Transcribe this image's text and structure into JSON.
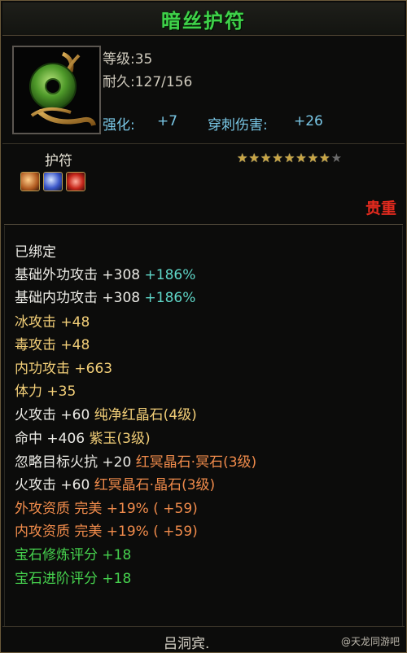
{
  "title": "暗丝护符",
  "stats": {
    "level": "等级:35",
    "durability": "耐久:127/156",
    "enhance_label": "强化:",
    "enhance_value": "+7",
    "pierce_label": "穿刺伤害:",
    "pierce_value": "+26"
  },
  "item_type": "护符",
  "stars": {
    "filled": 8,
    "total": 9
  },
  "valuable": "贵重",
  "attributes": {
    "bound": "已绑定",
    "ext_atk_label": "基础外功攻击",
    "ext_atk_value": "+308",
    "ext_atk_pct": "+186%",
    "int_atk_label": "基础内功攻击",
    "int_atk_value": "+308",
    "int_atk_pct": "+186%",
    "ice": "冰攻击 +48",
    "poison": "毒攻击 +48",
    "internal": "内功攻击 +663",
    "stamina": "体力 +35",
    "fire1_main": "火攻击 +60",
    "fire1_gem": "纯净红晶石(4级)",
    "hit_main": "命中 +406",
    "hit_gem": "紫玉(3级)",
    "ignore_main": "忽略目标火抗 +20",
    "ignore_gem": "红冥晶石·冥石(3级)",
    "fire2_main": "火攻击 +60",
    "fire2_gem": "红冥晶石·晶石(3级)",
    "ext_quality": "外攻资质  完美 +19% ( +59)",
    "int_quality": "内攻资质  完美 +19% ( +59)",
    "gem_refine": "宝石修炼评分 +18",
    "gem_advance": "宝石进阶评分 +18"
  },
  "signature": "吕洞宾.",
  "watermark": "@天龙同游吧",
  "colors": {
    "title_green": "#3fd24a",
    "valuable_red": "#e22a1e",
    "stat_blue": "#79c7e6",
    "gem_yellow": "#f3cf78",
    "gem_orange": "#f08b4b",
    "score_green": "#46d24e",
    "pct_cyan": "#5fd7c8"
  }
}
